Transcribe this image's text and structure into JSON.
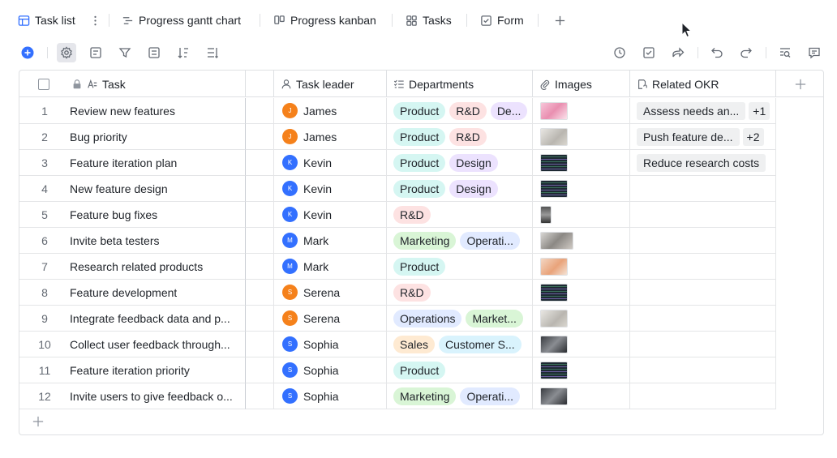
{
  "tabs": [
    {
      "label": "Task list",
      "icon": "table-icon"
    },
    {
      "label": "Progress gantt chart",
      "icon": "gantt-icon"
    },
    {
      "label": "Progress kanban",
      "icon": "kanban-icon"
    },
    {
      "label": "Tasks",
      "icon": "grid-icon"
    },
    {
      "label": "Form",
      "icon": "form-icon"
    }
  ],
  "columns": {
    "task": "Task",
    "leader": "Task leader",
    "departments": "Departments",
    "images": "Images",
    "okr": "Related OKR"
  },
  "colors": {
    "accent": "#3370ff",
    "Product": "#d5f6f2",
    "R&D": "#fde2e2",
    "Design": "#ece2fe",
    "Marketing": "#d9f5d6",
    "Operations": "#e1eaff",
    "Sales": "#feead2",
    "Customer Service": "#d9f3fd"
  },
  "rows": [
    {
      "index": "1",
      "task": "Review new features",
      "leader": {
        "name": "James",
        "initial": "J",
        "color": "#f5811b"
      },
      "departments": [
        "Product",
        "R&D",
        "De..."
      ],
      "image": "pink",
      "okr": [
        "Assess needs an...",
        "+1"
      ]
    },
    {
      "index": "2",
      "task": "Bug priority",
      "leader": {
        "name": "James",
        "initial": "J",
        "color": "#f5811b"
      },
      "departments": [
        "Product",
        "R&D"
      ],
      "image": "grey",
      "okr": [
        "Push feature de...",
        "+2"
      ]
    },
    {
      "index": "3",
      "task": "Feature iteration plan",
      "leader": {
        "name": "Kevin",
        "initial": "K",
        "color": "#3370ff"
      },
      "departments": [
        "Product",
        "Design"
      ],
      "image": "code",
      "okr": [
        "Reduce research costs"
      ]
    },
    {
      "index": "4",
      "task": "New feature design",
      "leader": {
        "name": "Kevin",
        "initial": "K",
        "color": "#3370ff"
      },
      "departments": [
        "Product",
        "Design"
      ],
      "image": "code",
      "okr": []
    },
    {
      "index": "5",
      "task": "Feature bug fixes",
      "leader": {
        "name": "Kevin",
        "initial": "K",
        "color": "#3370ff"
      },
      "departments": [
        "R&D"
      ],
      "image": "narrow",
      "okr": []
    },
    {
      "index": "6",
      "task": "Invite beta testers",
      "leader": {
        "name": "Mark",
        "initial": "M",
        "color": "#3370ff"
      },
      "departments": [
        "Marketing",
        "Operati..."
      ],
      "image": "wide",
      "okr": []
    },
    {
      "index": "7",
      "task": "Research related products",
      "leader": {
        "name": "Mark",
        "initial": "M",
        "color": "#3370ff"
      },
      "departments": [
        "Product"
      ],
      "image": "orange",
      "okr": []
    },
    {
      "index": "8",
      "task": "Feature development",
      "leader": {
        "name": "Serena",
        "initial": "S",
        "color": "#f5811b"
      },
      "departments": [
        "R&D"
      ],
      "image": "code",
      "okr": []
    },
    {
      "index": "9",
      "task": "Integrate feedback data and p...",
      "leader": {
        "name": "Serena",
        "initial": "S",
        "color": "#f5811b"
      },
      "departments": [
        "Operations",
        "Market..."
      ],
      "image": "grey",
      "okr": []
    },
    {
      "index": "10",
      "task": "Collect user feedback through...",
      "leader": {
        "name": "Sophia",
        "initial": "S",
        "color": "#3370ff"
      },
      "departments": [
        "Sales",
        "Customer S..."
      ],
      "image": "dark",
      "okr": []
    },
    {
      "index": "11",
      "task": "Feature iteration priority",
      "leader": {
        "name": "Sophia",
        "initial": "S",
        "color": "#3370ff"
      },
      "departments": [
        "Product"
      ],
      "image": "code",
      "okr": []
    },
    {
      "index": "12",
      "task": "Invite users to give feedback o...",
      "leader": {
        "name": "Sophia",
        "initial": "S",
        "color": "#3370ff"
      },
      "departments": [
        "Marketing",
        "Operati..."
      ],
      "image": "dark",
      "okr": []
    }
  ]
}
